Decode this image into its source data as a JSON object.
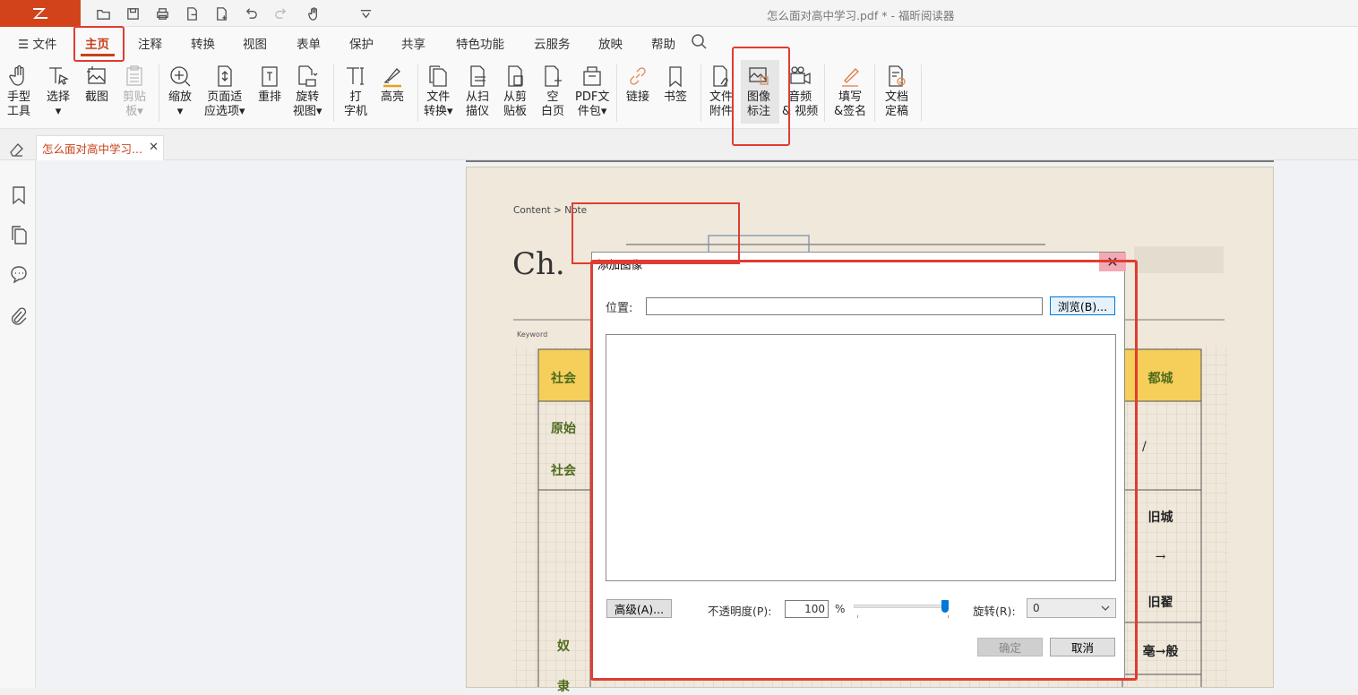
{
  "window": {
    "title": "怎么面对高中学习.pdf * - 福昕阅读器"
  },
  "menu": {
    "items": [
      "文件",
      "主页",
      "注释",
      "转换",
      "视图",
      "表单",
      "保护",
      "共享",
      "特色功能",
      "云服务",
      "放映",
      "帮助"
    ]
  },
  "ribbon": {
    "tools": [
      {
        "id": "hand",
        "label": "手型\n工具",
        "icon": "hand-icon"
      },
      {
        "id": "select",
        "label": "选择\n▾",
        "icon": "text-select-icon"
      },
      {
        "id": "screenshot",
        "label": "截图",
        "icon": "screenshot-icon"
      },
      {
        "id": "clipboard",
        "label": "剪贴\n板▾",
        "icon": "clipboard-icon"
      },
      {
        "id": "zoom",
        "label": "缩放\n▾",
        "icon": "zoom-icon"
      },
      {
        "id": "fit",
        "label": "页面适\n应选项▾",
        "icon": "fit-page-icon"
      },
      {
        "id": "reflow",
        "label": "重排",
        "icon": "reflow-icon"
      },
      {
        "id": "rotate",
        "label": "旋转\n视图▾",
        "icon": "rotate-view-icon"
      },
      {
        "id": "typewriter",
        "label": "打\n字机",
        "icon": "typewriter-icon"
      },
      {
        "id": "highlight",
        "label": "高亮",
        "icon": "highlighter-icon"
      },
      {
        "id": "convert",
        "label": "文件\n转换▾",
        "icon": "file-convert-icon"
      },
      {
        "id": "scan",
        "label": "从扫\n描仪",
        "icon": "scanner-icon"
      },
      {
        "id": "fromclip",
        "label": "从剪\n贴板",
        "icon": "paste-file-icon"
      },
      {
        "id": "blank",
        "label": "空\n白页",
        "icon": "blank-page-icon"
      },
      {
        "id": "package",
        "label": "PDF文\n件包▾",
        "icon": "pdf-package-icon"
      },
      {
        "id": "link",
        "label": "链接",
        "icon": "link-icon"
      },
      {
        "id": "bookmark",
        "label": "书签",
        "icon": "bookmark-icon"
      },
      {
        "id": "attach",
        "label": "文件\n附件",
        "icon": "file-attachment-icon"
      },
      {
        "id": "image",
        "label": "图像\n标注",
        "icon": "image-annotation-icon"
      },
      {
        "id": "av",
        "label": "音频\n& 视频",
        "icon": "video-camera-icon"
      },
      {
        "id": "fillsign",
        "label": "填写\n&签名",
        "icon": "pen-sign-icon"
      },
      {
        "id": "finalize",
        "label": "文档\n定稿",
        "icon": "finalize-doc-icon"
      }
    ]
  },
  "tab": {
    "label": "怎么面对高中学习..."
  },
  "document": {
    "breadcrumb": "Content  >  Note",
    "heading": "Ch.",
    "keyword": "Keyword",
    "cells_left": [
      "社会",
      "原始",
      "社会",
      "奴",
      "隶"
    ],
    "cells_right": [
      "都城",
      "/",
      "旧城",
      "→",
      "旧翟",
      "亳→般"
    ]
  },
  "dialog": {
    "title": "添加图像",
    "location_label": "位置:",
    "location_value": "",
    "browse_label": "浏览(B)...",
    "advanced_label": "高级(A)...",
    "opacity_label": "不透明度(P):",
    "opacity_value": "100",
    "opacity_unit": "%",
    "opacity_level": 1.0,
    "rotate_label": "旋转(R):",
    "rotate_value": "0",
    "ok_label": "确定",
    "cancel_label": "取消"
  },
  "colors": {
    "brand": "#d2431c",
    "highlight": "#e03c31",
    "accent_text": "#c8411a"
  }
}
